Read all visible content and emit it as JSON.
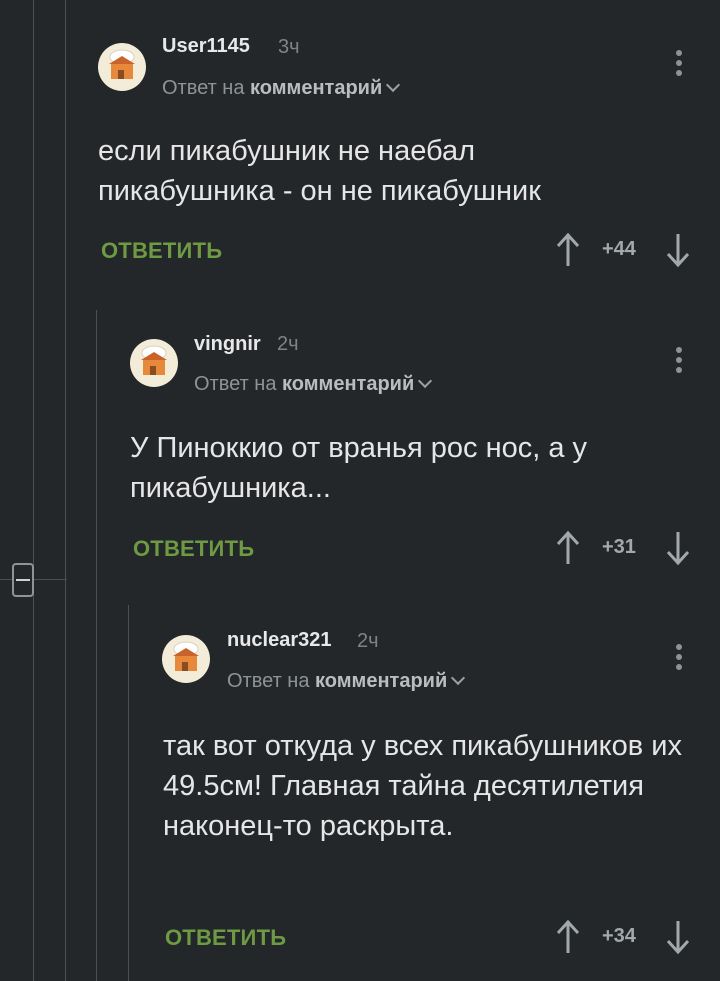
{
  "comments": [
    {
      "username": "User1145",
      "time": "3ч",
      "reply_prefix": "Ответ на",
      "reply_target": "комментарий",
      "text": "если пикабушник не наебал пикабушника - он не пикабушник",
      "reply_label": "ОТВЕТИТЬ",
      "rating": "+44"
    },
    {
      "username": "vingnir",
      "time": "2ч",
      "reply_prefix": "Ответ на",
      "reply_target": "комментарий",
      "text": "У Пиноккио от вранья рос нос, а у пикабушника...",
      "reply_label": "ОТВЕТИТЬ",
      "rating": "+31"
    },
    {
      "username": "nuclear321",
      "time": "2ч",
      "reply_prefix": "Ответ на",
      "reply_target": "комментарий",
      "text": "так вот откуда у всех пикабушников их 49.5см! Главная тайна десятилетия наконец-то раскрыта.",
      "reply_label": "ОТВЕТИТЬ",
      "rating": "+34"
    }
  ],
  "icons": {
    "avatar": "house-avatar-icon",
    "more": "more-vertical-icon",
    "upvote": "arrow-up-icon",
    "downvote": "arrow-down-icon",
    "collapse": "minus-collapse-icon"
  },
  "colors": {
    "background": "#24272a",
    "reply_button": "#6d9a42",
    "thread_line": "#4b5054"
  }
}
